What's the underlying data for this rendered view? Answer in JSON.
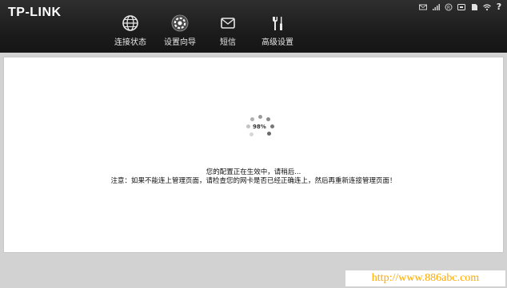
{
  "header": {
    "logo_text": "TP-LINK",
    "nav": [
      {
        "label": "连接状态",
        "icon": "globe-icon"
      },
      {
        "label": "设置向导",
        "icon": "settings-gear-icon",
        "active": true
      },
      {
        "label": "短信",
        "icon": "envelope-icon"
      },
      {
        "label": "高级设置",
        "icon": "tools-icon"
      }
    ],
    "status_icons": [
      "sms-icon",
      "signal-icon",
      "roaming-icon",
      "network-icon",
      "sim-icon",
      "wifi-icon",
      "help-icon"
    ],
    "help_label": "?"
  },
  "main": {
    "progress_percent": "98%",
    "message_line1": "您的配置正在生效中，请稍后...",
    "message_line2": "注意：如果不能连上管理页面，请检查您的网卡是否已经正确连上，然后再重新连接管理页面！"
  },
  "watermark": {
    "text": "http://www.886abc.com"
  },
  "colors": {
    "header_bg": "#1c1c1c",
    "content_bg": "#ffffff",
    "page_bg": "#d2d2d2",
    "watermark": "#ffaa00"
  }
}
